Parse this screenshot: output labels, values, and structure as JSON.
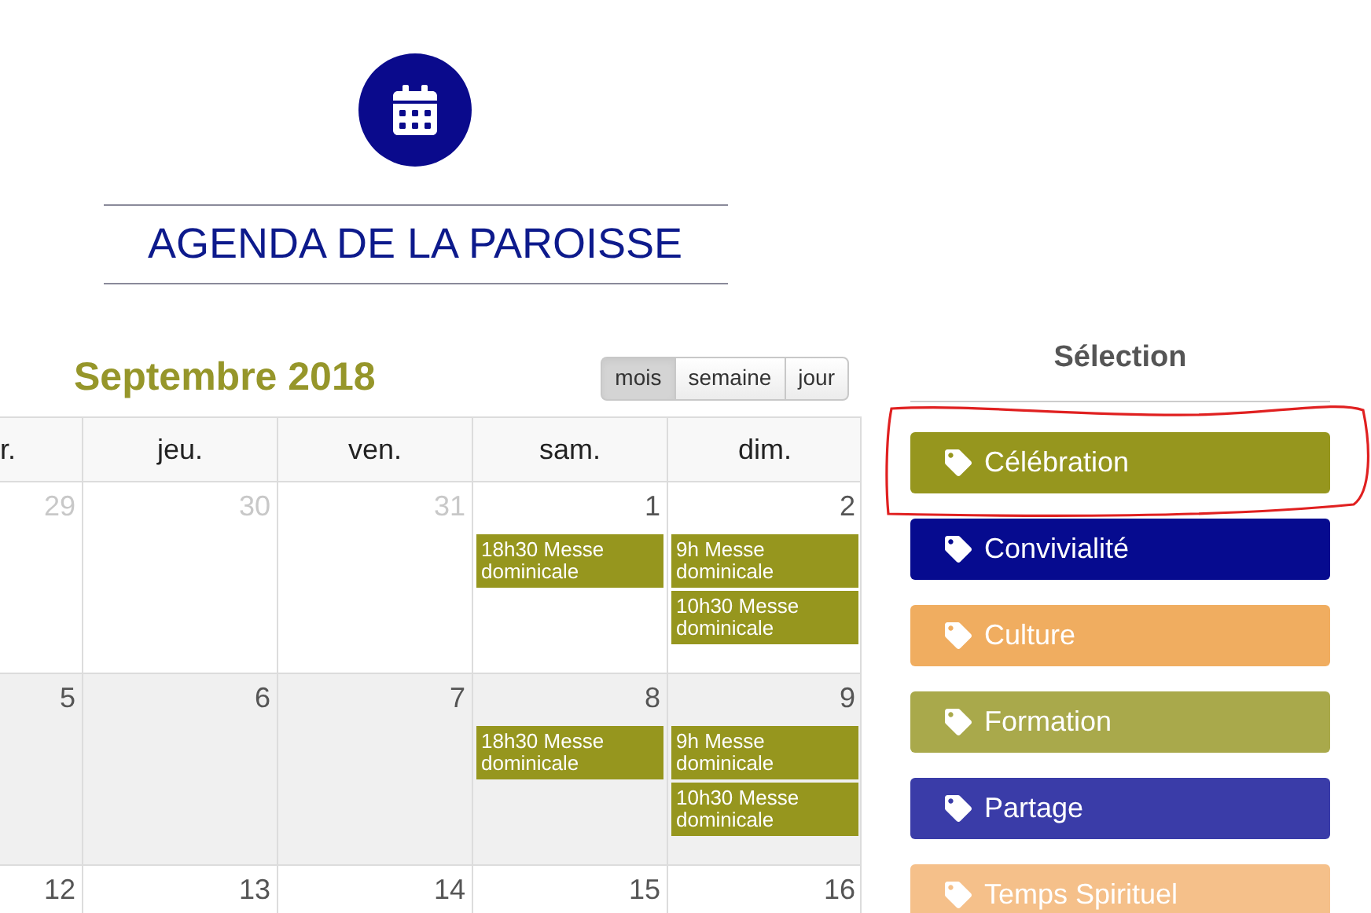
{
  "title": "AGENDA DE LA PAROISSE",
  "calendar": {
    "month": "Septembre 2018",
    "views": [
      {
        "label": "mois",
        "selected": true
      },
      {
        "label": "semaine",
        "selected": false
      },
      {
        "label": "jour",
        "selected": false
      }
    ],
    "weekdays": [
      "r.",
      "jeu.",
      "ven.",
      "sam.",
      "dim."
    ],
    "weeks": [
      {
        "highlighted": false,
        "days": [
          {
            "day": "29",
            "muted": true
          },
          {
            "day": "30",
            "muted": true
          },
          {
            "day": "31",
            "muted": true
          },
          {
            "day": "1",
            "muted": false,
            "events": [
              "18h30 Messe dominicale"
            ]
          },
          {
            "day": "2",
            "muted": false,
            "events": [
              "9h Messe dominicale",
              "10h30 Messe dominicale"
            ]
          }
        ]
      },
      {
        "highlighted": true,
        "days": [
          {
            "day": "5",
            "muted": false
          },
          {
            "day": "6",
            "muted": false
          },
          {
            "day": "7",
            "muted": false
          },
          {
            "day": "8",
            "muted": false,
            "events": [
              "18h30 Messe dominicale"
            ]
          },
          {
            "day": "9",
            "muted": false,
            "events": [
              "9h Messe dominicale",
              "10h30 Messe dominicale"
            ]
          }
        ]
      },
      {
        "highlighted": false,
        "days": [
          {
            "day": "12",
            "muted": false
          },
          {
            "day": "13",
            "muted": false
          },
          {
            "day": "14",
            "muted": false
          },
          {
            "day": "15",
            "muted": false
          },
          {
            "day": "16",
            "muted": false
          }
        ]
      }
    ]
  },
  "selection": {
    "heading": "Sélection",
    "categories": [
      {
        "label": "Célébration",
        "color": "#96961e"
      },
      {
        "label": "Convivialité",
        "color": "#060b8f"
      },
      {
        "label": "Culture",
        "color": "#f0ad60"
      },
      {
        "label": "Formation",
        "color": "#a9a94b"
      },
      {
        "label": "Partage",
        "color": "#3a3ca8"
      },
      {
        "label": "Temps Spirituel",
        "color": "#f5c08a"
      }
    ]
  }
}
